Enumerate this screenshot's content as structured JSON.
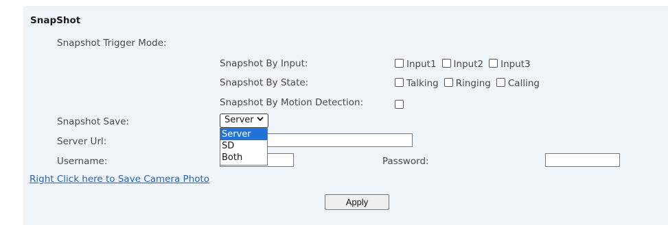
{
  "section": {
    "title": "SnapShot"
  },
  "trigger": {
    "label": "Snapshot Trigger Mode:",
    "by_input": {
      "label": "Snapshot By Input:",
      "options": [
        "Input1",
        "Input2",
        "Input3"
      ]
    },
    "by_state": {
      "label": "Snapshot By State:",
      "options": [
        "Talking",
        "Ringing",
        "Calling"
      ]
    },
    "by_motion": {
      "label": "Snapshot By Motion Detection:"
    }
  },
  "save": {
    "label": "Snapshot Save:",
    "selected": "Server",
    "options": [
      "Server",
      "SD",
      "Both"
    ]
  },
  "server_url": {
    "label": "Server Url:",
    "value": ""
  },
  "username": {
    "label": "Username:",
    "value": ""
  },
  "password": {
    "label": "Password:",
    "value": ""
  },
  "link": {
    "text": "Right Click here to Save Camera Photo"
  },
  "apply": {
    "label": "Apply"
  },
  "colors": {
    "panel_bg": "#eef4f7",
    "selected_option_bg": "#1e72d8",
    "link": "#2b5fb3"
  }
}
